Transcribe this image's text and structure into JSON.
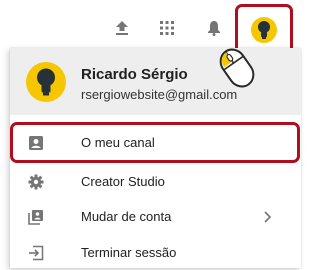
{
  "topbar": {
    "icons": [
      "upload-icon",
      "apps-icon",
      "bell-icon"
    ],
    "avatar_icon": "lightbulb-icon"
  },
  "account_menu": {
    "user_name": "Ricardo Sérgio",
    "user_email": "rsergiowebsite@gmail.com",
    "items": [
      {
        "label": "O meu canal",
        "icon": "channel-icon",
        "highlighted": true
      },
      {
        "label": "Creator Studio",
        "icon": "gear-icon"
      },
      {
        "label": "Mudar de conta",
        "icon": "switch-account-icon",
        "has_submenu": true
      },
      {
        "label": "Terminar sessão",
        "icon": "sign-out-icon"
      }
    ]
  },
  "colors": {
    "highlight": "#b00d1f",
    "avatar": "#f6c700",
    "profile_bg": "#eeeeee",
    "icon": "#757575"
  }
}
